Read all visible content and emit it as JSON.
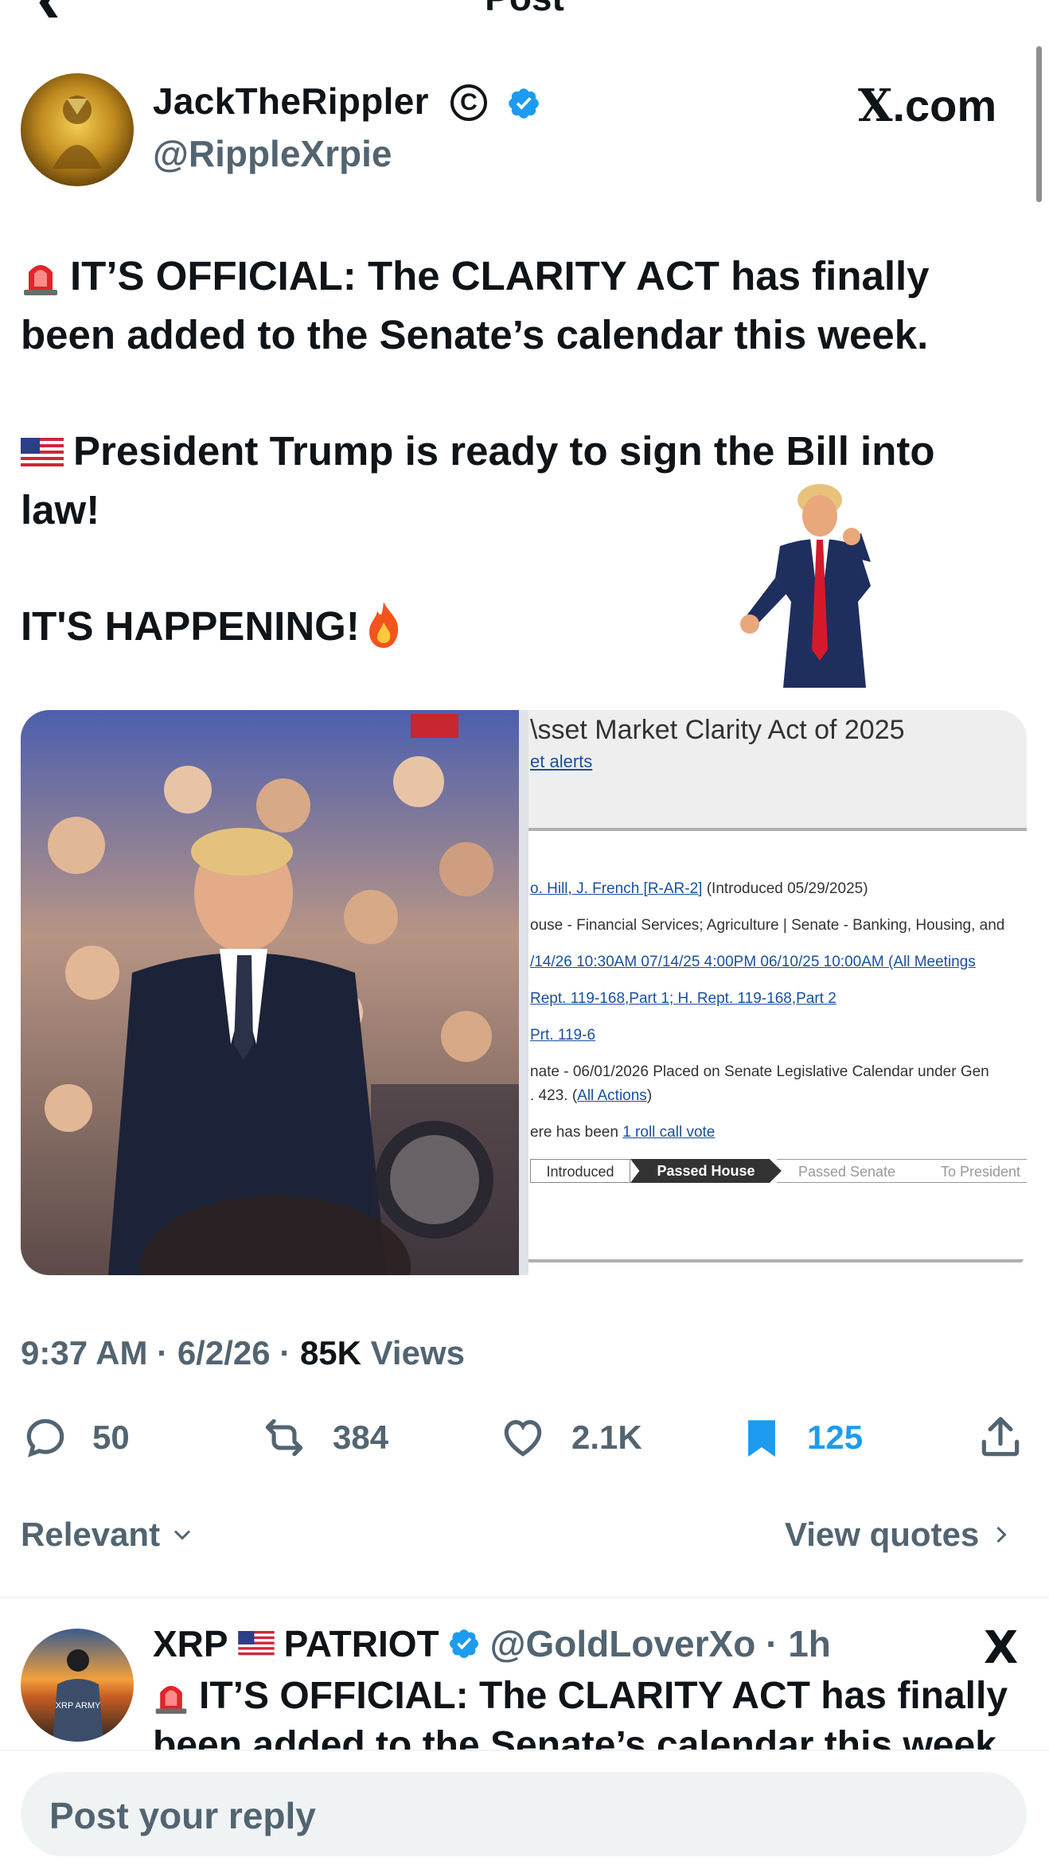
{
  "header": {
    "title": "Post",
    "back_icon": "back-arrow-icon"
  },
  "post": {
    "author": {
      "name": "JackTheRippler",
      "handle": "@RippleXrpie",
      "badges": [
        "copyright-icon",
        "verified-icon"
      ],
      "verified_color": "#1d9bf0"
    },
    "source": {
      "x_letter": "X",
      "suffix": ".com"
    },
    "text": {
      "line1": "IT’S OFFICIAL: The CLARITY ACT has finally",
      "line2": "been added to the Senate’s calendar this week.",
      "line3": "President Trump is ready to sign the Bill into",
      "line4": "law!",
      "line5": "IT'S HAPPENING!",
      "emoji": [
        "siren-icon",
        "us-flag-icon",
        "fire-icon"
      ]
    },
    "media": {
      "right_doc": {
        "title": "\\sset Market Clarity Act of 2025",
        "alerts": "et alerts",
        "sponsor_link": "o. Hill, J. French [R-AR-2]",
        "sponsor_rest": " (Introduced 05/29/2025)",
        "committees": "ouse - Financial Services; Agriculture | Senate - Banking, Housing, and",
        "meetings": "/14/26 10:30AM 07/14/25 4:00PM 06/10/25 10:00AM (All Meetings",
        "reports": "Rept. 119-168,Part 1; H. Rept. 119-168,Part 2",
        "print": "Prt. 119-6",
        "action_line1": "nate - 06/01/2026 Placed on Senate Legislative Calendar under Gen",
        "action_line2_pre": ". 423. (",
        "action_line2_link": "All Actions",
        "action_line2_post": ")",
        "votes_pre": "ere has been ",
        "votes_link": "1 roll call vote",
        "tracker": [
          "Introduced",
          "Passed House",
          "Passed Senate",
          "To President"
        ]
      }
    },
    "meta": {
      "time": "9:37 AM",
      "date": "6/2/26",
      "views_count": "85K",
      "views_label": "Views"
    },
    "actions": {
      "replies": "50",
      "reposts": "384",
      "likes": "2.1K",
      "bookmarks": "125",
      "bookmark_color": "#1d9bf0"
    },
    "sort": {
      "label": "Relevant",
      "quotes_label": "View quotes"
    }
  },
  "reply": {
    "name_part1": "XRP",
    "name_part2": "PATRIOT",
    "handle_time": "@GoldLoverXo · 1h",
    "x_mark": "X",
    "avatar_text": "XRP ARMY",
    "line1": "IT’S OFFICIAL: The CLARITY ACT has finally",
    "line2": "been added to the Senate’s calendar this week."
  },
  "reply_bar": {
    "placeholder": "Post your reply"
  }
}
